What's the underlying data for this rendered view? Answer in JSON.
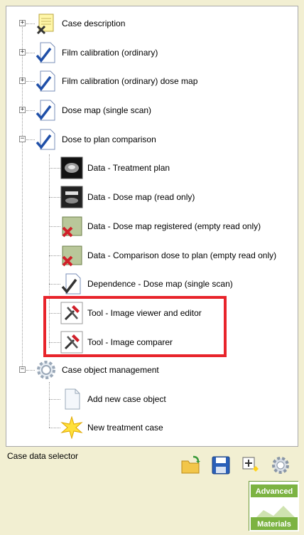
{
  "tree": {
    "nodes": [
      {
        "label": "Case description",
        "icon": "notepad-x-icon"
      },
      {
        "label": "Film calibration (ordinary)",
        "icon": "document-check-icon"
      },
      {
        "label": "Film calibration (ordinary) dose map",
        "icon": "document-check-icon"
      },
      {
        "label": "Dose map (single scan)",
        "icon": "document-check-icon"
      },
      {
        "label": "Dose to plan comparison",
        "icon": "document-check-icon"
      },
      {
        "label": "Data - Treatment plan",
        "icon": "image-thumbnail-icon"
      },
      {
        "label": "Data - Dose map (read only)",
        "icon": "image-thumbnail-icon"
      },
      {
        "label": "Data - Dose map registered (empty read only)",
        "icon": "image-x-icon"
      },
      {
        "label": "Data - Comparison dose to plan (empty read only)",
        "icon": "image-x-icon"
      },
      {
        "label": "Dependence - Dose map (single scan)",
        "icon": "document-check-icon"
      },
      {
        "label": "Tool - Image viewer and editor",
        "icon": "tools-icon"
      },
      {
        "label": "Tool - Image comparer",
        "icon": "tools-icon"
      },
      {
        "label": "Case object management",
        "icon": "gear-icon"
      },
      {
        "label": "Add new case object",
        "icon": "blank-document-icon"
      },
      {
        "label": "New treatment case",
        "icon": "star-icon"
      }
    ]
  },
  "footer": {
    "label": "Case data selector"
  },
  "toolbar": {
    "buttons": [
      "open-folder-icon",
      "save-icon",
      "add-item-icon",
      "settings-icon"
    ]
  },
  "logo": {
    "line1": "Advanced",
    "line2": "Materials"
  },
  "colors": {
    "background": "#f2efd2",
    "highlight": "#e8242b",
    "check": "#1f4fa8"
  }
}
